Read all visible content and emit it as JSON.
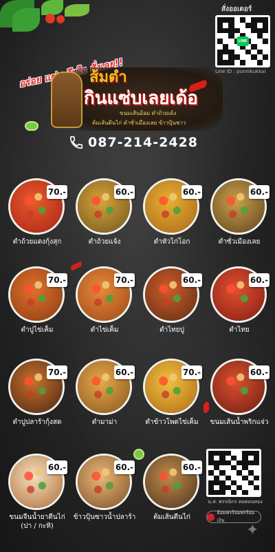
{
  "header": {
    "slogan": "อร่อย แซ่บ ถึงใจ สั่งเลย!!",
    "order_label": "สั่งออเดอร์",
    "line_badge": "LINE",
    "line_id": "Line ID : punnikukkai",
    "logo_line1": "ส้มตำ",
    "logo_line2": "กินแซ่บเลยเด้อ",
    "logo_sub1": "ขนมเส้นอ้อม ตำถ้วยเด้ง",
    "logo_sub2": "ต้มเส้นตีนไก่ ตำซั่วเมืองเลย ข้าวปุ้นซาว",
    "phone": "087-214-2428"
  },
  "menu": [
    {
      "name": "ตำถ้วยแดงกุ้งสุก",
      "price": "70.-"
    },
    {
      "name": "ตำถ้วยแจ้ง",
      "price": "60.-"
    },
    {
      "name": "ตำหัวไก่โอก",
      "price": "60.-"
    },
    {
      "name": "ตำซั่วเมืองเลย",
      "price": "60.-"
    },
    {
      "name": "ตำปูไข่เค็ม",
      "price": "70.-"
    },
    {
      "name": "ตำไข่เค็ม",
      "price": "70.-"
    },
    {
      "name": "ตำไทยปู",
      "price": "60.-"
    },
    {
      "name": "ตำไทย",
      "price": "60.-"
    },
    {
      "name": "ตำปูปลาร้ากุ้งสด",
      "price": "70.-"
    },
    {
      "name": "ตำมาม่า",
      "price": "60.-"
    },
    {
      "name": "ตำข้าวโพดไข่เค็ม",
      "price": "70.-"
    },
    {
      "name": "ขนมเส้นน้ำพริกแจ่ว",
      "price": "60.-"
    },
    {
      "name": "ขนมจีนน้ำยาตีนไก่\n(ปา / กะทิ)",
      "price": "60.-"
    },
    {
      "name": "ข้าวปุ้นซาวน้ำปลาร้า",
      "price": "60.-"
    },
    {
      "name": "ต้มเส้นตีนไก่",
      "price": "60.-"
    }
  ],
  "payment": {
    "account_name": "น.ส. พรรณิกร ตมดอนทอง",
    "bank": "ย้อมพรร้อมพรร้อมเงิน"
  },
  "colors": {
    "background": "#242424",
    "accent_red": "#e8282b",
    "logo_yellow": "#f0c020",
    "line_green": "#06c755"
  },
  "icons": [
    "phone-icon",
    "line-icon",
    "qr-code",
    "sparkle-icon",
    "chili-icon",
    "lime-icon"
  ]
}
